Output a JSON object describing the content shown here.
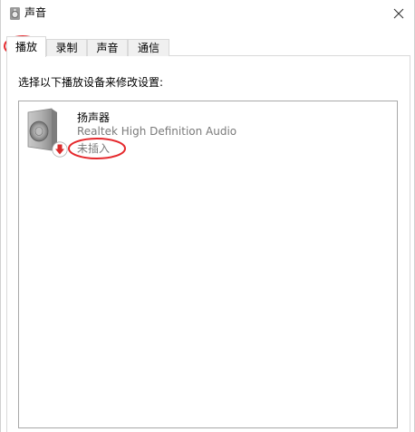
{
  "window": {
    "title": "声音",
    "close_icon": "close-icon"
  },
  "tabs": [
    {
      "label": "播放",
      "active": true
    },
    {
      "label": "录制",
      "active": false
    },
    {
      "label": "声音",
      "active": false
    },
    {
      "label": "通信",
      "active": false
    }
  ],
  "playback": {
    "instruction": "选择以下播放设备来修改设置:",
    "devices": [
      {
        "name": "扬声器",
        "driver": "Realtek High Definition Audio",
        "status": "未插入",
        "icon": "speaker-icon",
        "status_icon": "unplugged-arrow-icon"
      }
    ]
  },
  "colors": {
    "annotation_red": "#e5282c",
    "status_badge_red": "#d92b2b",
    "secondary_text": "#7a7a7a"
  }
}
